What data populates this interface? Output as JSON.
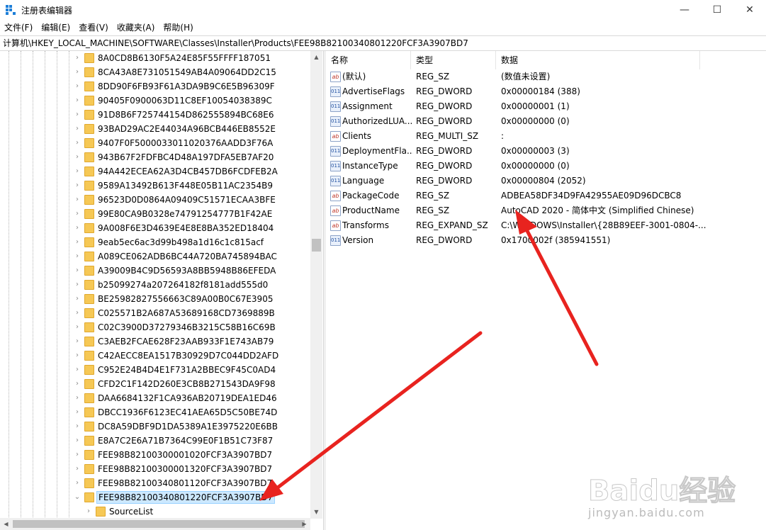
{
  "window": {
    "title": "注册表编辑器",
    "controls": {
      "minimize": "—",
      "maximize": "☐",
      "close": "✕"
    }
  },
  "menu": [
    "文件(F)",
    "编辑(E)",
    "查看(V)",
    "收藏夹(A)",
    "帮助(H)"
  ],
  "address": "计算机\\HKEY_LOCAL_MACHINE\\SOFTWARE\\Classes\\Installer\\Products\\FEE98B82100340801220FCF3A3907BD7",
  "tree": {
    "items": [
      "8A0CD8B6130F5A24E85F55FFFF187051",
      "8CA43A8E731051549AB4A09064DD2C15",
      "8DD90F6FB93F61A3DA9B9C6E5B96309F",
      "90405F0900063D11C8EF10054038389C",
      "91D8B6F725744154D862555894BC68E6",
      "93BAD29AC2E44034A96BCB446EB8552E",
      "9407F0F5000033011020376AADD3F76A",
      "943B67F2FDFBC4D48A197DFA5EB7AF20",
      "94A442ECEA62A3D4CB457DB6FCDFEB2A",
      "9589A13492B613F448E05B11AC2354B9",
      "96523D0D0864A09409C51571ECAA3BFE",
      "99E80CA9B0328e74791254777B1F42AE",
      "9A008F6E3D4639E4E8E8BA352ED18404",
      "9eab5ec6ac3d99b498a1d16c1c815acf",
      "A089CE062ADB6BC44A720BA745894BAC",
      "A39009B4C9D56593A8BB5948B86EFEDA",
      "b25099274a207264182f8181add555d0",
      "BE25982827556663C89A00B0C67E3905",
      "C025571B2A687A53689168CD7369889B",
      "C02C3900D37279346B3215C58B16C69B",
      "C3AEB2FCAE628F23AAB933F1E743AB79",
      "C42AECC8EA1517B30929D7C044DD2AFD",
      "C952E24B4D4E1F731A2BBEC9F45C0AD4",
      "CFD2C1F142D260E3CB8B271543DA9F98",
      "DAA6684132F1CA936AB20719DEA1ED46",
      "DBCC1936F6123EC41AEA65D5C50BE74D",
      "DC8A59DBF9D1DA5389A1E3975220E6BB",
      "E8A7C2E6A71B7364C99E0F1B51C73F87",
      "FEE98B82100300001020FCF3A3907BD7",
      "FEE98B82100300001320FCF3A3907BD7",
      "FEE98B82100340801120FCF3A3907BD7"
    ],
    "selected": "FEE98B82100340801220FCF3A3907BD7",
    "child": "SourceList",
    "chevron_collapsed": "›",
    "chevron_expanded": "⌄"
  },
  "values": {
    "columns": [
      "名称",
      "类型",
      "数据"
    ],
    "rows": [
      {
        "icon": "string-value-icon",
        "name": "(默认)",
        "type": "REG_SZ",
        "data": "(数值未设置)"
      },
      {
        "icon": "binary-value-icon",
        "name": "AdvertiseFlags",
        "type": "REG_DWORD",
        "data": "0x00000184 (388)"
      },
      {
        "icon": "binary-value-icon",
        "name": "Assignment",
        "type": "REG_DWORD",
        "data": "0x00000001 (1)"
      },
      {
        "icon": "binary-value-icon",
        "name": "AuthorizedLUA...",
        "type": "REG_DWORD",
        "data": "0x00000000 (0)"
      },
      {
        "icon": "string-value-icon",
        "name": "Clients",
        "type": "REG_MULTI_SZ",
        "data": ":"
      },
      {
        "icon": "binary-value-icon",
        "name": "DeploymentFla...",
        "type": "REG_DWORD",
        "data": "0x00000003 (3)"
      },
      {
        "icon": "binary-value-icon",
        "name": "InstanceType",
        "type": "REG_DWORD",
        "data": "0x00000000 (0)"
      },
      {
        "icon": "binary-value-icon",
        "name": "Language",
        "type": "REG_DWORD",
        "data": "0x00000804 (2052)"
      },
      {
        "icon": "string-value-icon",
        "name": "PackageCode",
        "type": "REG_SZ",
        "data": "ADBEA58DF34D9FA42955AE09D96DCBC8"
      },
      {
        "icon": "string-value-icon",
        "name": "ProductName",
        "type": "REG_SZ",
        "data": "AutoCAD 2020 - 简体中文 (Simplified Chinese)"
      },
      {
        "icon": "string-value-icon",
        "name": "Transforms",
        "type": "REG_EXPAND_SZ",
        "data": "C:\\WINDOWS\\Installer\\{28B89EEF-3001-0804-..."
      },
      {
        "icon": "binary-value-icon",
        "name": "Version",
        "type": "REG_DWORD",
        "data": "0x1700002f (385941551)"
      }
    ],
    "icon_labels": {
      "sz": "ab",
      "bin": "011"
    }
  },
  "colors": {
    "selection": "#cce8ff",
    "folder": "#f6c855",
    "annotation_arrow": "#e8231f",
    "app_icon": "#1e7fd8"
  },
  "watermark": {
    "main": "Baidu经验",
    "sub": "jingyan.baidu.com"
  }
}
